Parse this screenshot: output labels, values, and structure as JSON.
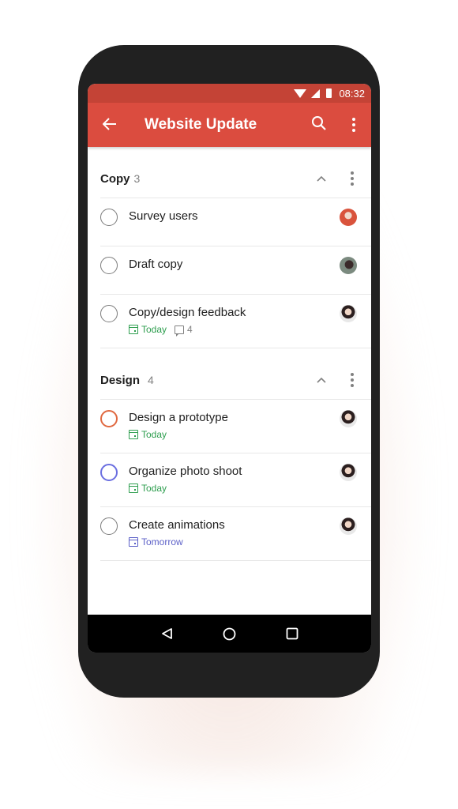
{
  "status_bar": {
    "time": "08:32"
  },
  "app_bar": {
    "title": "Website Update",
    "back_icon": "arrow-left-icon",
    "search_icon": "search-icon",
    "more_icon": "more-vert-icon"
  },
  "colors": {
    "accent": "#db4c3f",
    "status_bar": "#c44336",
    "today": "#2e9e4f",
    "tomorrow": "#5b5fc7",
    "priority_orange": "#e0683f",
    "priority_blue": "#6a6ee0"
  },
  "sections": [
    {
      "name": "Copy",
      "count": "3",
      "tasks": [
        {
          "title": "Survey users",
          "avatar": "avatar-red"
        },
        {
          "title": "Draft copy",
          "avatar": "avatar-dark"
        },
        {
          "title": "Copy/design feedback",
          "due": "Today",
          "comments": "4",
          "avatar": "avatar-woman"
        }
      ]
    },
    {
      "name": "Design",
      "count": "4",
      "tasks": [
        {
          "title": "Design a prototype",
          "due": "Today",
          "priority": "orange",
          "avatar": "avatar-woman"
        },
        {
          "title": "Organize photo shoot",
          "due": "Today",
          "priority": "blue",
          "avatar": "avatar-woman"
        },
        {
          "title": "Create animations",
          "due": "Tomorrow",
          "avatar": "avatar-woman"
        }
      ]
    }
  ],
  "nav_bar": {
    "back": "nav-back-icon",
    "home": "nav-home-icon",
    "recents": "nav-recents-icon"
  }
}
